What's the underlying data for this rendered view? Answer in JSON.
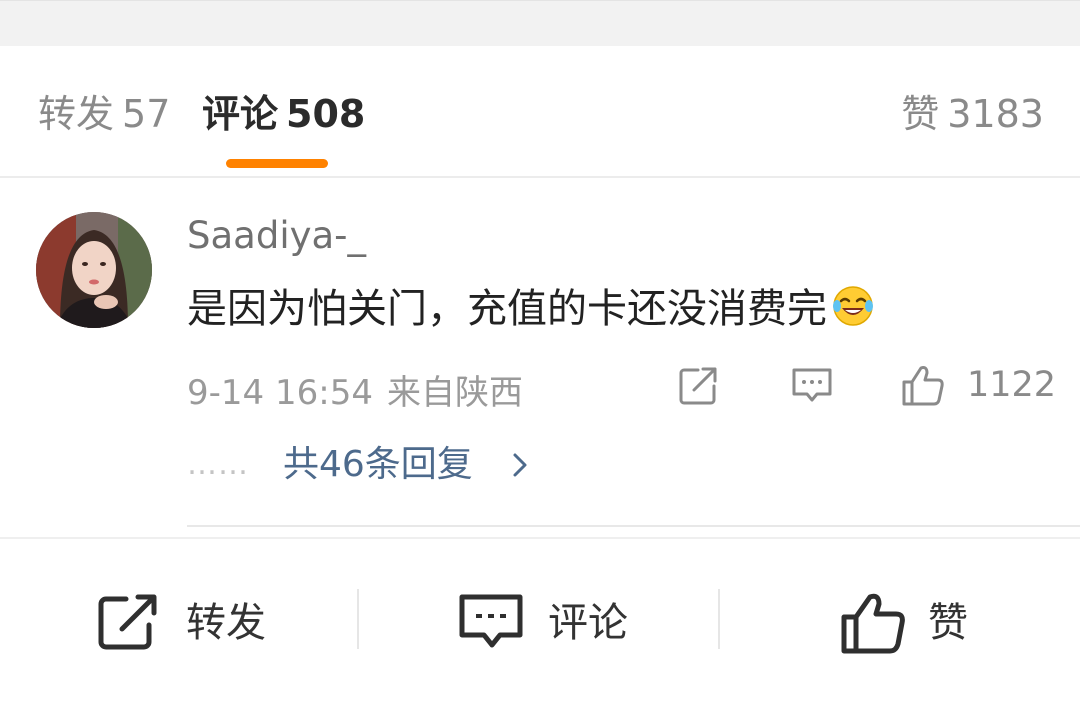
{
  "tabs": {
    "repost_label": "转发",
    "repost_count": "57",
    "comment_label": "评论",
    "comment_count": "508",
    "like_label": "赞",
    "like_count": "3183",
    "active_color": "#ff8200"
  },
  "comment": {
    "username": "Saadiya-_",
    "text": "是因为怕关门，充值的卡还没消费完",
    "emoji": "laugh-cry-emoji",
    "time": "9-14 16:54",
    "location": "来自陕西",
    "like_count": "1122",
    "reply_dots": "……",
    "reply_link": "共46条回复"
  },
  "bottom_bar": {
    "repost_label": "转发",
    "comment_label": "评论",
    "like_label": "赞"
  },
  "colors": {
    "accent": "#ff8200",
    "link": "#4d6a8c",
    "muted_text": "#8a8a8a"
  }
}
